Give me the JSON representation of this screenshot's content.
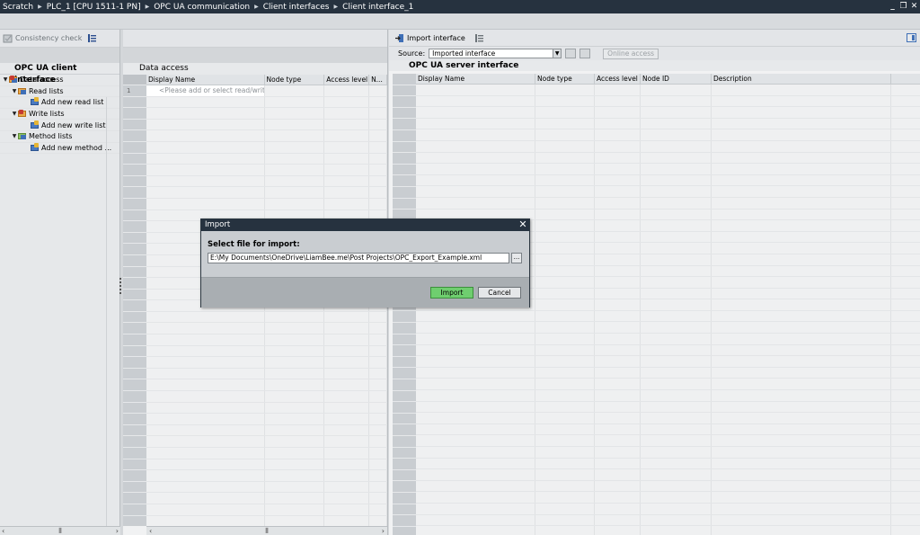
{
  "breadcrumb": [
    "Scratch",
    "PLC_1 [CPU 1511-1 PN]",
    "OPC UA communication",
    "Client interfaces",
    "Client interface_1"
  ],
  "window_buttons": [
    "minimize-icon",
    "restore-icon",
    "close-icon"
  ],
  "left_panel": {
    "consistency_check_label": "Consistency check",
    "title": "OPC UA client interface",
    "tree": [
      {
        "label": "Data access",
        "level": 0,
        "expanded": true
      },
      {
        "label": "Read lists",
        "level": 1,
        "expanded": true
      },
      {
        "label": "Add new read list",
        "level": 2
      },
      {
        "label": "Write lists",
        "level": 1,
        "expanded": true
      },
      {
        "label": "Add new write list",
        "level": 2
      },
      {
        "label": "Method lists",
        "level": 1,
        "expanded": true
      },
      {
        "label": "Add new method ...",
        "level": 2
      }
    ]
  },
  "center_panel": {
    "title": "Data access",
    "columns": [
      "Display Name",
      "Node type",
      "Access level",
      "N..."
    ],
    "row_number": "1",
    "placeholder": "<Please add or select read/write..."
  },
  "right_panel": {
    "import_interface_label": "Import interface",
    "source_label": "Source:",
    "source_value": "Imported interface",
    "online_access_label": "Online access",
    "title": "OPC UA server interface",
    "columns": [
      "Display Name",
      "Node type",
      "Access level",
      "Node ID",
      "Description"
    ]
  },
  "dialog": {
    "title": "Import",
    "prompt": "Select file for import:",
    "file_path": "E:\\My Documents\\OneDrive\\LiamBee.me\\Post Projects\\OPC_Export_Example.xml",
    "browse_label": "...",
    "import_button": "Import",
    "cancel_button": "Cancel"
  },
  "colors": {
    "titlebar": "#26323f",
    "import_button": "#6fce6f",
    "panel_bg": "#f1f2f3"
  }
}
